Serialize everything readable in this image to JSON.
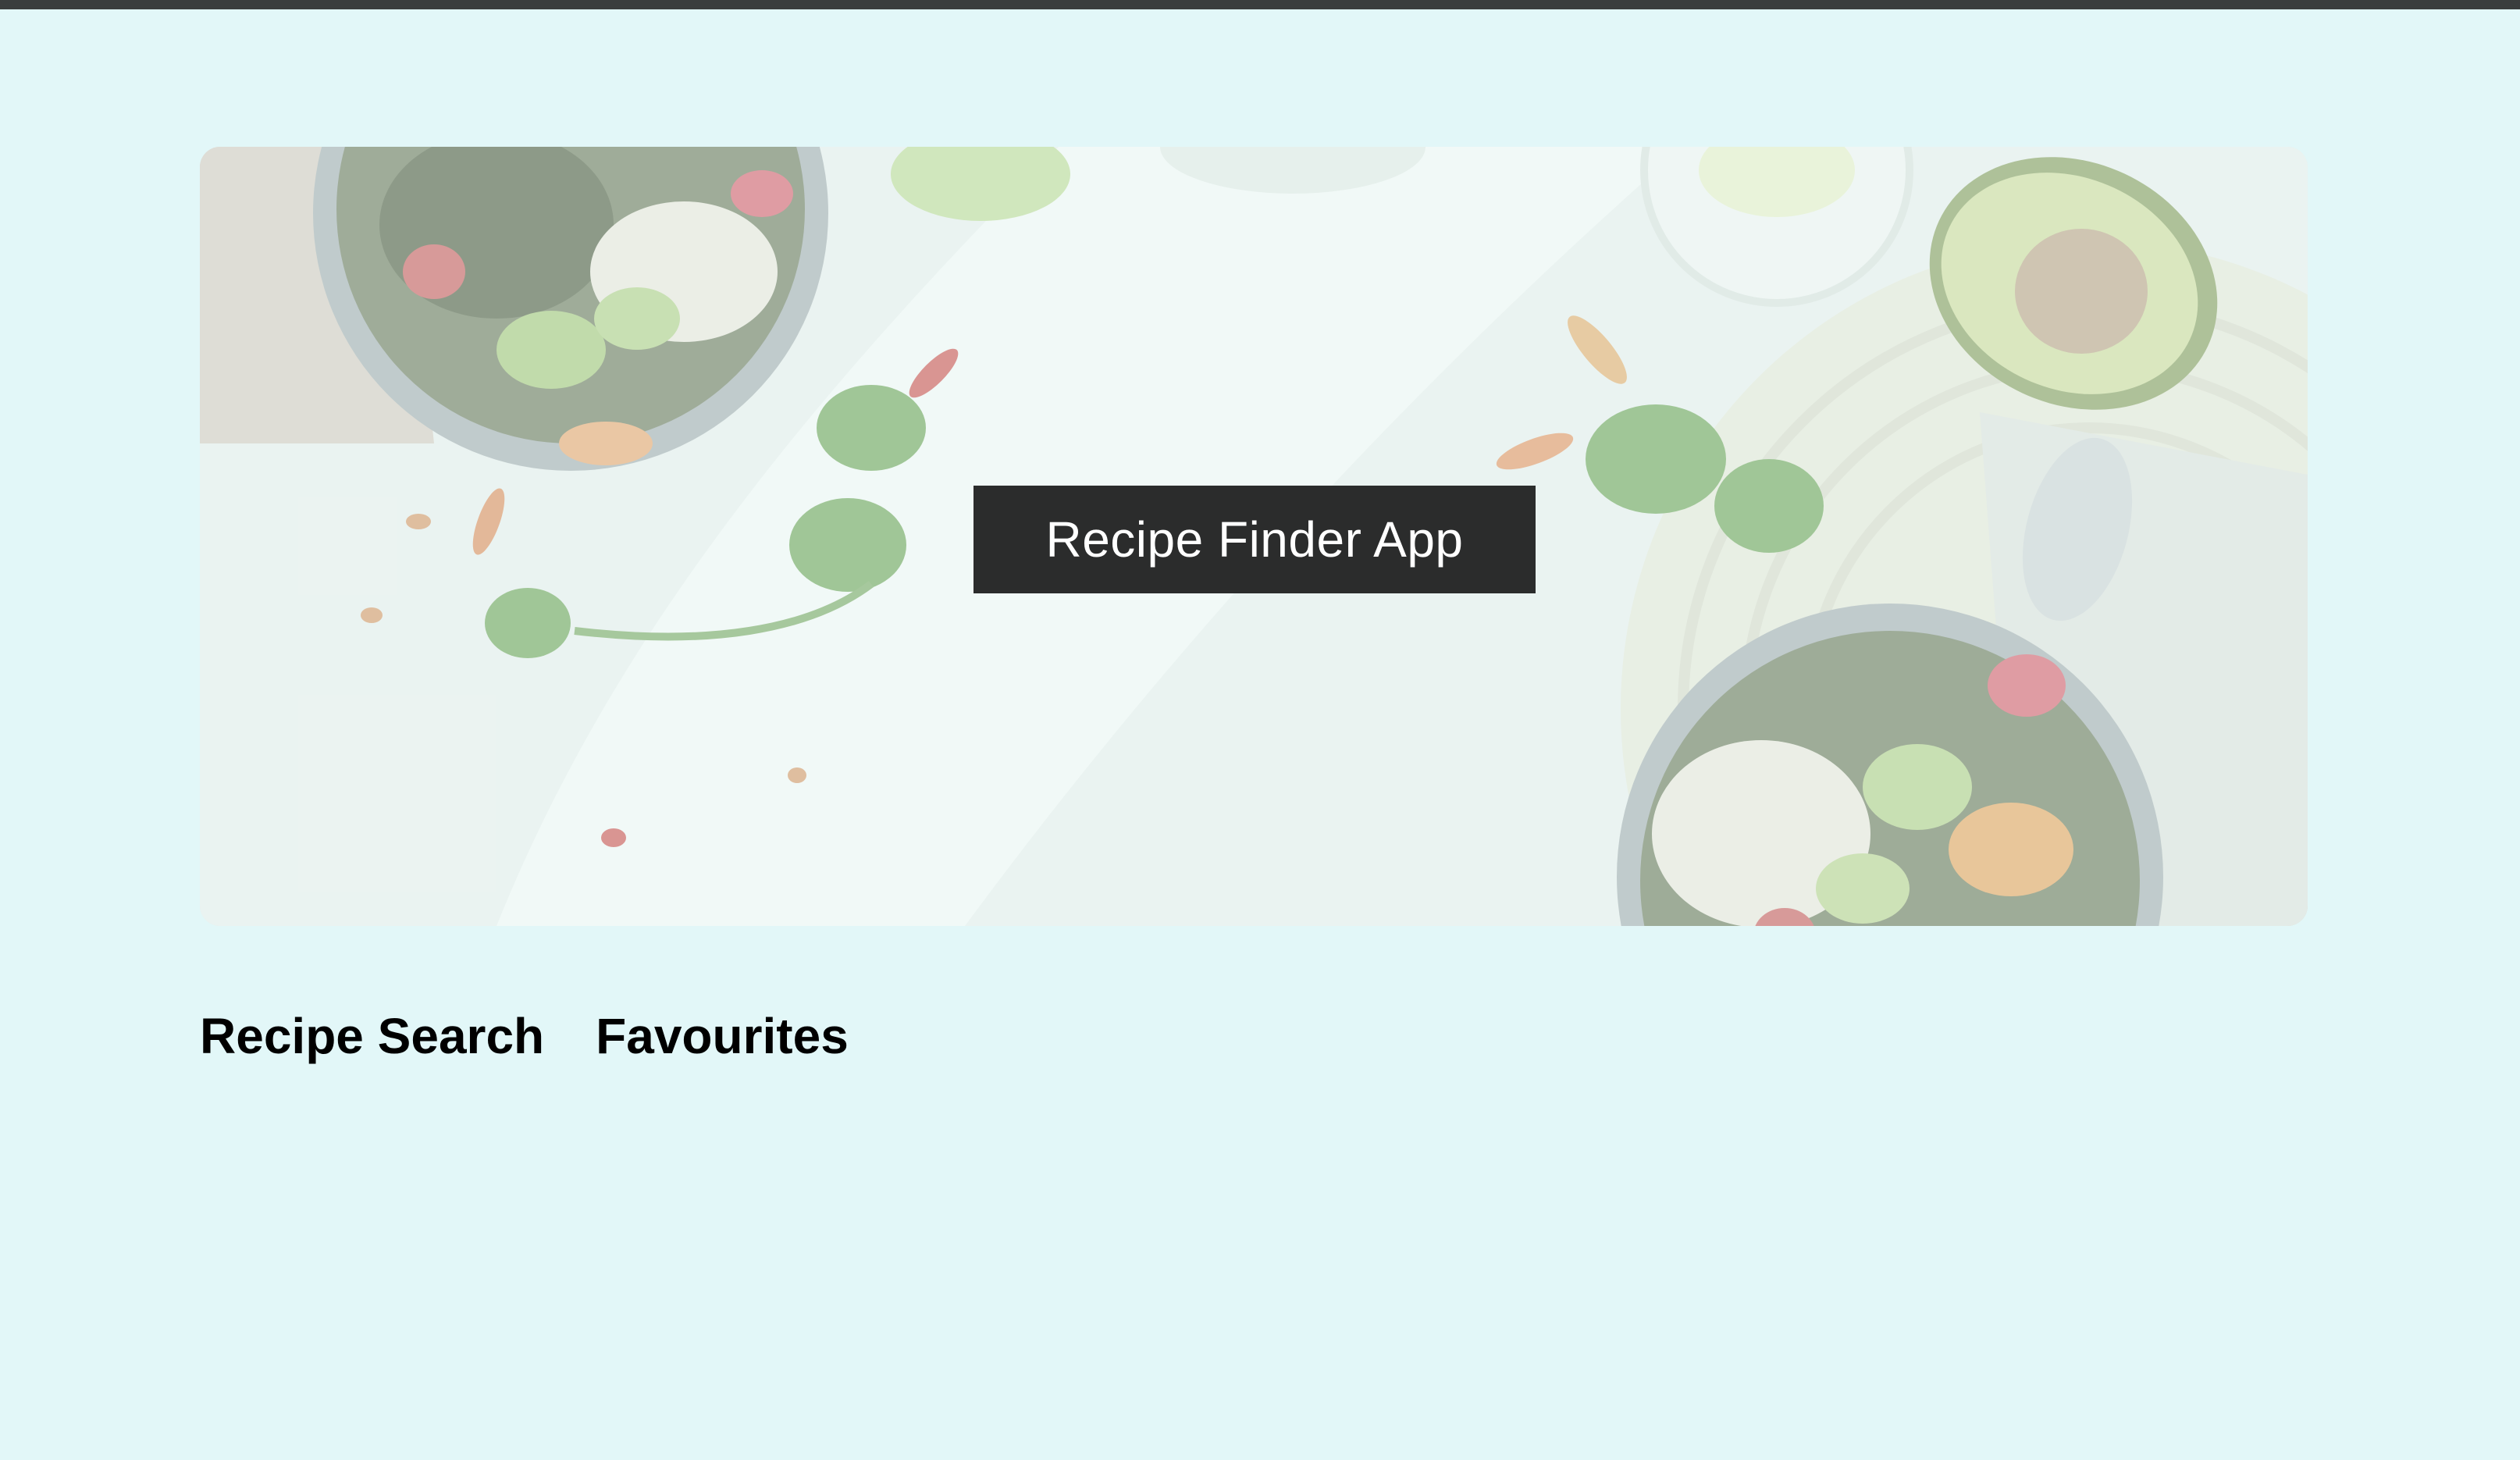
{
  "header": {
    "title": "Recipe Finder App"
  },
  "hero": {
    "image": "food-bowls-photo"
  },
  "nav": {
    "items": [
      {
        "label": "Recipe Search"
      },
      {
        "label": "Favourites"
      }
    ]
  },
  "colors": {
    "page_background": "#e2f7f8",
    "top_bar": "#3a3d3d",
    "title_box": "#2b2c2c",
    "title_text": "#ffffff",
    "nav_text": "#000000"
  }
}
